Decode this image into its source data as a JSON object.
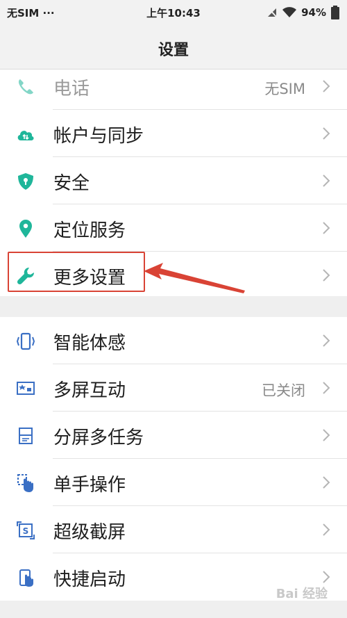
{
  "status_bar": {
    "carrier": "无SIM ···",
    "time": "上午10:43",
    "battery": "94%"
  },
  "header": {
    "title": "设置"
  },
  "group1": {
    "items": [
      {
        "label": "电话",
        "value": "无SIM",
        "icon": "phone-icon"
      },
      {
        "label": "帐户与同步",
        "value": "",
        "icon": "cloud-sync-icon"
      },
      {
        "label": "安全",
        "value": "",
        "icon": "shield-lock-icon"
      },
      {
        "label": "定位服务",
        "value": "",
        "icon": "location-pin-icon"
      },
      {
        "label": "更多设置",
        "value": "",
        "icon": "wrench-icon"
      }
    ]
  },
  "group2": {
    "items": [
      {
        "label": "智能体感",
        "value": "",
        "icon": "motion-phone-icon"
      },
      {
        "label": "多屏互动",
        "value": "已关闭",
        "icon": "screen-cast-icon"
      },
      {
        "label": "分屏多任务",
        "value": "",
        "icon": "split-screen-icon"
      },
      {
        "label": "单手操作",
        "value": "",
        "icon": "one-hand-icon"
      },
      {
        "label": "超级截屏",
        "value": "",
        "icon": "screenshot-icon"
      },
      {
        "label": "快捷启动",
        "value": "",
        "icon": "quick-launch-icon"
      }
    ]
  },
  "colors": {
    "accent_teal": "#1fb69a",
    "accent_blue": "#3a6fc4",
    "annotation_red": "#d94335"
  },
  "watermark": "Bai 经验"
}
